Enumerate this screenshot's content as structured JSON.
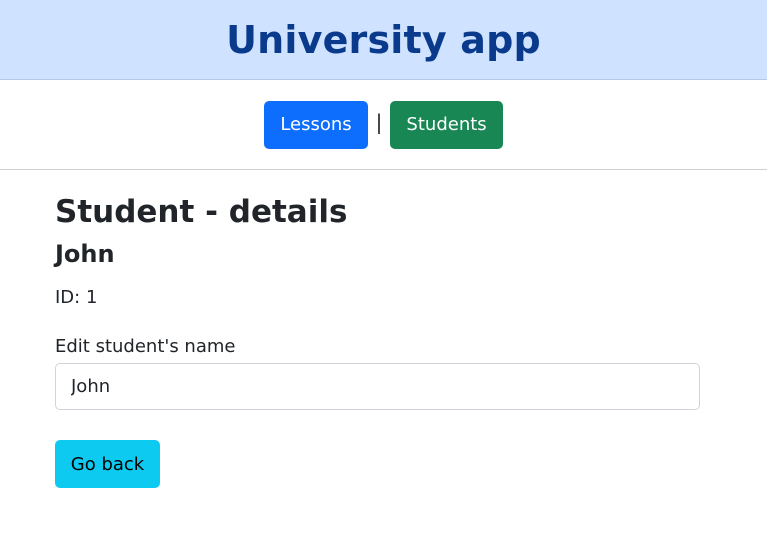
{
  "header": {
    "title": "University app"
  },
  "nav": {
    "lessons_label": "Lessons",
    "separator": "|",
    "students_label": "Students"
  },
  "main": {
    "page_title": "Student - details",
    "student_name": "John",
    "id_line": "ID: 1",
    "edit_label": "Edit student's name",
    "name_input_value": "John",
    "back_button_label": "Go back"
  },
  "colors": {
    "header_bg": "#cfe2ff",
    "header_title": "#0a3a8c",
    "lessons_button": "#0d6efd",
    "students_button": "#198754",
    "back_button": "#0dcaf0"
  }
}
